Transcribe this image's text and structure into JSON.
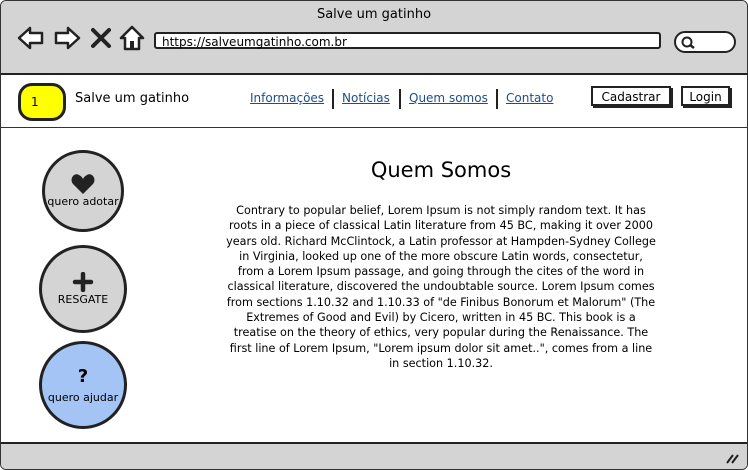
{
  "browser": {
    "title": "Salve um gatinho",
    "url": "https://salveumgatinho.com.br",
    "nav_icons": [
      "back-icon",
      "forward-icon",
      "close-icon",
      "home-icon"
    ],
    "search_icon": "search-icon"
  },
  "site": {
    "logo_text": "1",
    "name": "Salve um gatinho",
    "menu": [
      {
        "label": "Informações"
      },
      {
        "label": "Notícias"
      },
      {
        "label": "Quem somos"
      },
      {
        "label": "Contato"
      }
    ],
    "register_label": "Cadastrar",
    "login_label": "Login"
  },
  "sidebar": {
    "items": [
      {
        "icon": "heart-icon",
        "label": "quero adotar",
        "color": "#d4d4d4"
      },
      {
        "icon": "plus-icon",
        "label": "RESGATE",
        "color": "#d4d4d4"
      },
      {
        "icon": "question-icon",
        "label": "quero ajudar",
        "color": "#a3c4f5"
      }
    ]
  },
  "main": {
    "title": "Quem Somos",
    "body": "Contrary to popular belief, Lorem Ipsum is not simply random text. It has roots in a piece of classical Latin literature from 45 BC, making it over 2000 years old. Richard McClintock, a Latin professor at Hampden-Sydney College in Virginia, looked up one of the more obscure Latin words, consectetur, from a Lorem Ipsum passage, and going through the cites of the word in classical literature, discovered the undoubtable source. Lorem Ipsum comes from sections 1.10.32 and 1.10.33 of \"de Finibus Bonorum et Malorum\" (The Extremes of Good and Evil) by Cicero, written in 45 BC. This book is a treatise on the theory of ethics, very popular during the Renaissance. The first line of Lorem Ipsum, \"Lorem ipsum dolor sit amet..\", comes from a line in section 1.10.32."
  },
  "status": {
    "resize_icon": "resize-grip-icon"
  }
}
